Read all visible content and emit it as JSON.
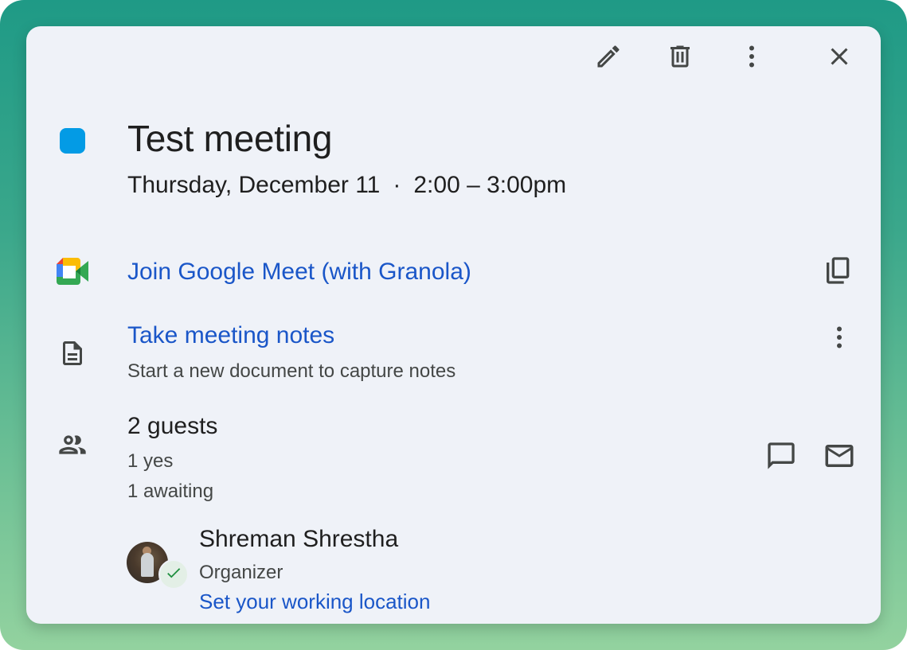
{
  "event": {
    "title": "Test meeting",
    "date": "Thursday, December 11",
    "separator": "·",
    "time": "2:00 – 3:00pm",
    "color": "#039be5"
  },
  "toolbar": {
    "edit_icon": "pencil-icon",
    "delete_icon": "trash-icon",
    "more_icon": "more-vert-icon",
    "close_icon": "close-icon"
  },
  "meet": {
    "label": "Join Google Meet (with Granola)",
    "icon": "google-meet-icon",
    "copy_icon": "copy-icon"
  },
  "notes": {
    "label": "Take meeting notes",
    "subtitle": "Start a new document to capture notes",
    "icon": "document-icon",
    "more_icon": "more-vert-icon"
  },
  "guests": {
    "count_label": "2 guests",
    "yes_label": "1 yes",
    "awaiting_label": "1 awaiting",
    "icon": "people-icon",
    "chat_icon": "chat-icon",
    "email_icon": "mail-icon",
    "list": [
      {
        "name": "Shreman Shrestha",
        "role": "Organizer",
        "action": "Set your working location",
        "status_icon": "check-icon"
      }
    ]
  },
  "colors": {
    "link": "#1a56c8",
    "card_bg": "#eff2f8",
    "accept_green": "#1e8e3e"
  }
}
